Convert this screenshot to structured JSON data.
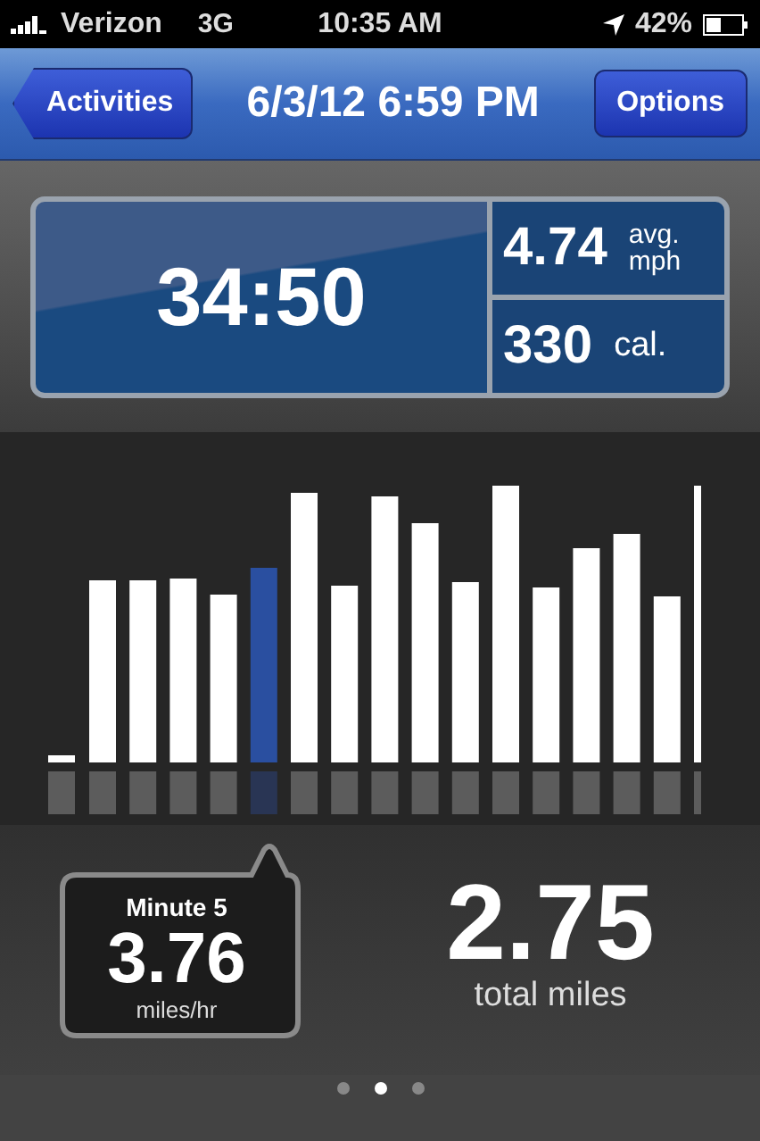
{
  "status_bar": {
    "carrier": "Verizon",
    "network": "3G",
    "time": "10:35 AM",
    "battery": "42%"
  },
  "nav_bar": {
    "back_button": "Activities",
    "title": "6/3/12 6:59 PM",
    "right_button": "Options"
  },
  "stats": {
    "duration": "34:50",
    "speed": "4.74",
    "speed_unit": "avg.\nmph",
    "calories": "330",
    "calories_unit": "cal."
  },
  "callout": {
    "title": "Minute 5",
    "value": "3.76",
    "unit": "miles/hr"
  },
  "total": {
    "value": "2.75",
    "label": "total miles"
  },
  "page_dots": [
    {
      "selected": false
    },
    {
      "selected": true
    },
    {
      "selected": false
    }
  ]
}
